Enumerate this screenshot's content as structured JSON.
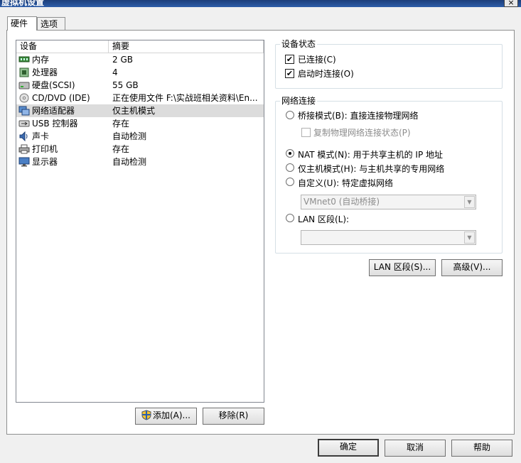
{
  "window": {
    "title": "虚拟机设置",
    "close_glyph": "×"
  },
  "tabs": [
    {
      "label": "硬件",
      "active": true
    },
    {
      "label": "选项",
      "active": false
    }
  ],
  "device_list": {
    "columns": [
      "设备",
      "摘要"
    ],
    "rows": [
      {
        "name": "内存",
        "summary": "2 GB",
        "icon": "memory-icon"
      },
      {
        "name": "处理器",
        "summary": "4",
        "icon": "processor-icon"
      },
      {
        "name": "硬盘(SCSI)",
        "summary": "55 GB",
        "icon": "hard-disk-icon"
      },
      {
        "name": "CD/DVD (IDE)",
        "summary": "正在使用文件 F:\\实战班相关资料\\En...",
        "icon": "cd-dvd-icon"
      },
      {
        "name": "网络适配器",
        "summary": "仅主机模式",
        "icon": "network-adapter-icon",
        "selected": true
      },
      {
        "name": "USB 控制器",
        "summary": "存在",
        "icon": "usb-icon"
      },
      {
        "name": "声卡",
        "summary": "自动检测",
        "icon": "sound-card-icon"
      },
      {
        "name": "打印机",
        "summary": "存在",
        "icon": "printer-icon"
      },
      {
        "name": "显示器",
        "summary": "自动检测",
        "icon": "display-icon"
      }
    ]
  },
  "list_buttons": {
    "add": "添加(A)...",
    "remove": "移除(R)"
  },
  "device_status": {
    "legend": "设备状态",
    "connected": {
      "label": "已连接(C)",
      "checked": true
    },
    "connect_on_power": {
      "label": "启动时连接(O)",
      "checked": true
    }
  },
  "network": {
    "legend": "网络连接",
    "bridged": {
      "label": "桥接模式(B): 直接连接物理网络",
      "selected": false
    },
    "replicate": {
      "label": "复制物理网络连接状态(P)",
      "checked": false
    },
    "nat": {
      "label": "NAT 模式(N): 用于共享主机的 IP 地址",
      "selected": true
    },
    "host_only": {
      "label": "仅主机模式(H): 与主机共享的专用网络",
      "selected": false
    },
    "custom": {
      "label": "自定义(U): 特定虚拟网络",
      "selected": false
    },
    "custom_value": "VMnet0 (自动桥接)",
    "lan": {
      "label": "LAN 区段(L):",
      "selected": false
    },
    "lan_value": ""
  },
  "network_buttons": {
    "lan_segments": "LAN 区段(S)...",
    "advanced": "高级(V)..."
  },
  "dialog_buttons": {
    "ok": "确定",
    "cancel": "取消",
    "help": "帮助"
  },
  "colors": {
    "title_bar": "#1c3e7a",
    "selection": "#dcdcdc",
    "dialog_bg": "#f0f0f0"
  }
}
